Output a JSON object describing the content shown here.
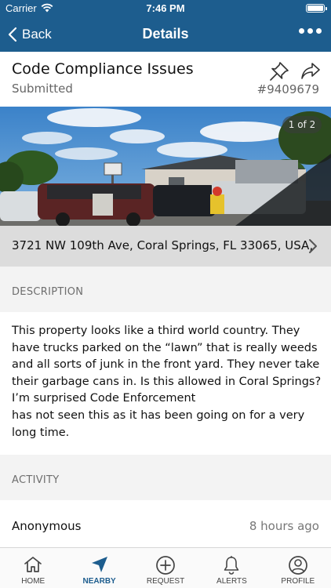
{
  "status_bar": {
    "carrier": "Carrier",
    "time": "7:46 PM"
  },
  "nav": {
    "back_label": "Back",
    "title": "Details"
  },
  "issue": {
    "title": "Code Compliance Issues",
    "status": "Submitted",
    "id": "#9409679"
  },
  "photo": {
    "counter": "1 of 2"
  },
  "address": "3721 NW 109th Ave, Coral Springs, FL 33065, USA,",
  "description": {
    "header": "DESCRIPTION",
    "text": "This property looks like a third world country. They have trucks parked on the “lawn” that is really weeds and all sorts of junk in the front yard. They never take their garbage cans in. Is this allowed in Coral Springs?  I’m surprised Code Enforcement\nhas not seen this as it has been going on for a very long time."
  },
  "activity": {
    "header": "ACTIVITY",
    "items": [
      {
        "user": "Anonymous",
        "time": "8 hours ago"
      }
    ]
  },
  "tabs": [
    {
      "label": "HOME",
      "icon": "home-icon"
    },
    {
      "label": "NEARBY",
      "icon": "location-arrow-icon",
      "active": true
    },
    {
      "label": "REQUEST",
      "icon": "plus-circle-icon"
    },
    {
      "label": "ALERTS",
      "icon": "bell-icon"
    },
    {
      "label": "PROFILE",
      "icon": "profile-icon"
    }
  ],
  "colors": {
    "brand": "#1d5d8e",
    "section_bg": "#f3f3f3",
    "address_bg": "#dcdcdc"
  }
}
